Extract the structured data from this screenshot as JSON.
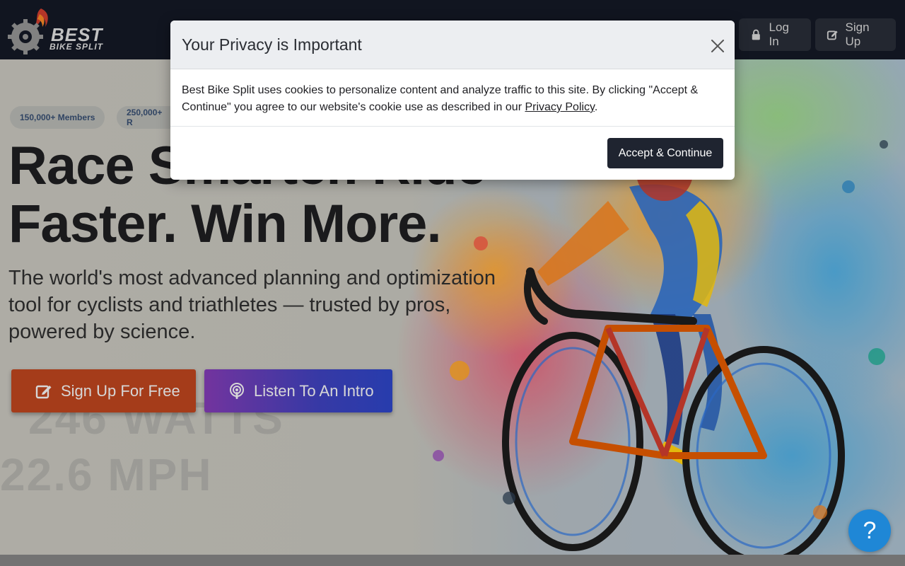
{
  "brand": {
    "line1": "BEST",
    "line2": "BIKE SPLIT"
  },
  "nav": {
    "login_label": "Log In",
    "signup_label": "Sign Up"
  },
  "hero": {
    "pills": [
      "150,000+ Members",
      "250,000+ R"
    ],
    "headline_line1": "Race Smarter. Ride",
    "headline_line2": "Faster. Win More.",
    "subline": "The world's most advanced planning and optimization tool for cyclists and triathletes — trusted by pros, powered by science.",
    "cta_free": "Sign Up For Free",
    "cta_intro": "Listen To An Intro"
  },
  "modal": {
    "title": "Your Privacy is Important",
    "body_text": "Best Bike Split uses cookies to personalize content and analyze traffic to this site. By clicking \"Accept & Continue\" you agree to our website's cookie use as described in our ",
    "policy_link": "Privacy Policy",
    "body_end": ".",
    "accept_label": "Accept & Continue"
  },
  "help": {
    "label": "?"
  },
  "colors": {
    "header_bg": "#131722",
    "cta_free": "#b0401c",
    "cta_intro": "#3b3db0",
    "accept_bg": "#1f2430",
    "help_bg": "#1f87d6"
  },
  "icons": {
    "login": "lock-icon",
    "signup": "edit-icon",
    "intro": "podcast-icon",
    "close": "close-icon",
    "logo": "gear-flame-logo"
  }
}
